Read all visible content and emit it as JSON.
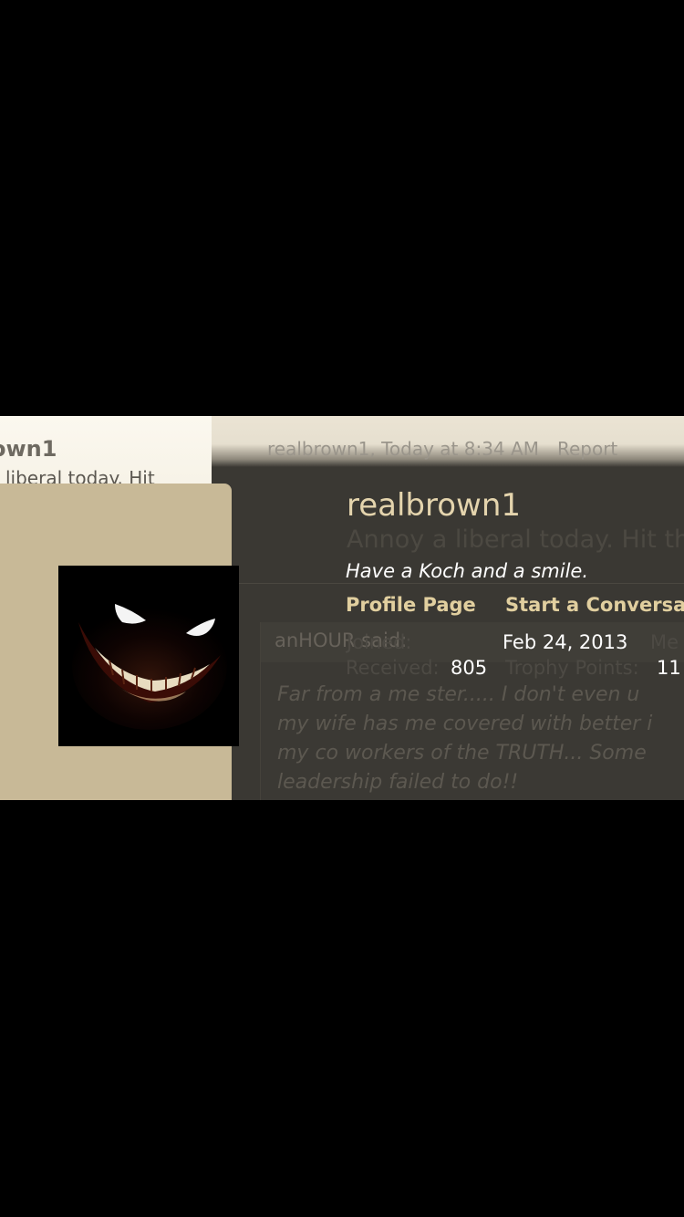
{
  "background_page": {
    "left_username": "own1",
    "left_snippet": "liberal today. Hit",
    "post_author": "realbrown1",
    "post_time": "Today at 8:34 AM",
    "report_label": "Report"
  },
  "member_card": {
    "username": "realbrown1",
    "ghost_signature": "Annoy a liberal today. Hit the",
    "custom_title": "Have a Koch and a smile.",
    "links": {
      "profile": "Profile Page",
      "conversation": "Start a Conversa"
    },
    "stats": {
      "joined_label": "Joined:",
      "joined_value": "Feb 24, 2013",
      "messages_label": "Me",
      "messages_value": "805",
      "likes_label": "Received:",
      "trophy_label": "Trophy Points:",
      "trophy_value": "11"
    }
  },
  "quote": {
    "author_line": "anHOUR said:",
    "lines": [
      "Far from a me ster..... I don't even u",
      "my wife has me covered with better i",
      "my co workers of the TRUTH... Some",
      "leadership failed to do!!"
    ]
  },
  "colors": {
    "accent": "#e1cf9f",
    "card_left": "#c8b997",
    "panel": "#3a3833"
  }
}
